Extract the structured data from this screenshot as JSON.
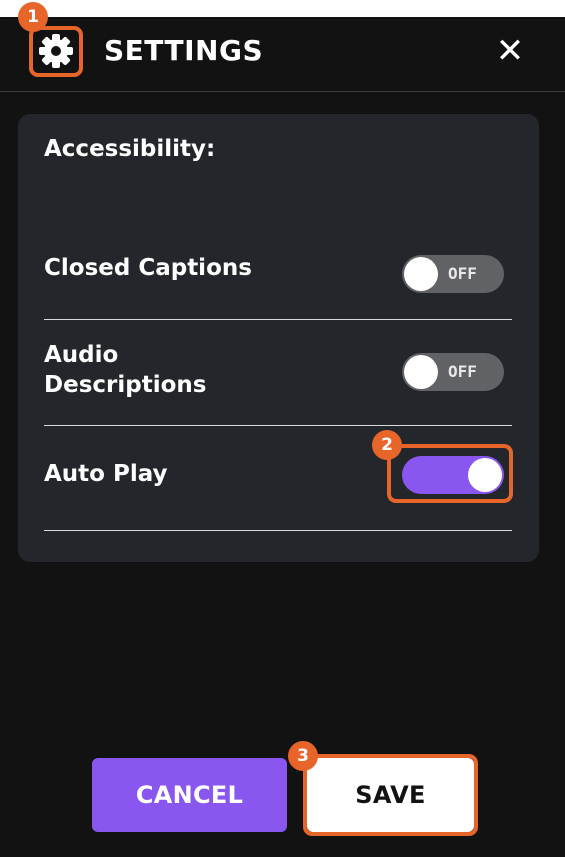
{
  "header": {
    "title": "SETTINGS",
    "close_label": "✕",
    "icon": "gear-icon"
  },
  "card": {
    "section_title": "Accessibility:",
    "rows": [
      {
        "label": "Closed Captions",
        "state": "OFF",
        "on": false
      },
      {
        "label_line1": "Audio",
        "label_line2": "Descriptions",
        "state": "OFF",
        "on": false
      },
      {
        "label": "Auto Play",
        "state": "",
        "on": true
      }
    ]
  },
  "buttons": {
    "cancel": "CANCEL",
    "save": "SAVE"
  },
  "annotations": [
    "1",
    "2",
    "3"
  ],
  "colors": {
    "panel": "#121212",
    "card": "#23262a",
    "accent": "#8a56f0",
    "highlight": "#e8652a",
    "toggle_off": "#606266"
  }
}
